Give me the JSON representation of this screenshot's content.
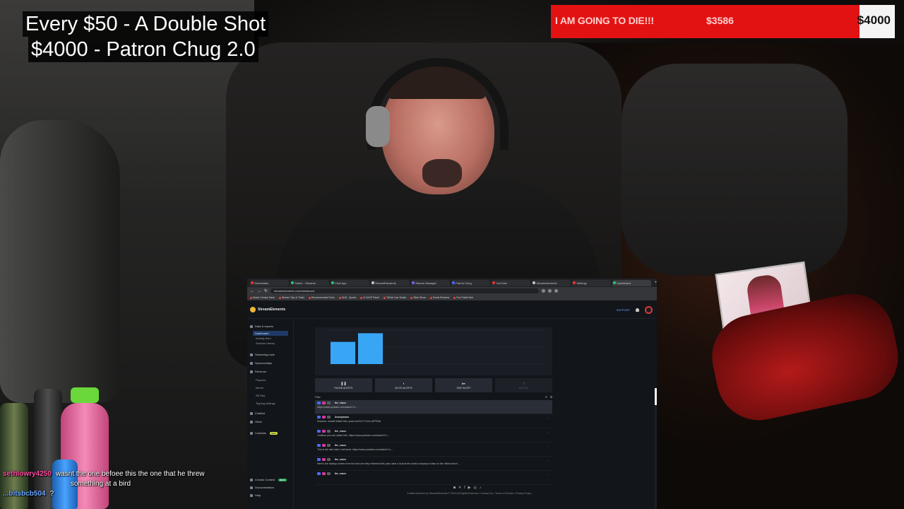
{
  "overlay": {
    "line1": "Every $50 - A Double Shot",
    "line2": "$4000 - Patron Chug 2.0"
  },
  "goal": {
    "title": "I AM GOING TO DIE!!!",
    "current": "$3586",
    "target": "$4000",
    "progress_fraction": 0.8965,
    "fill_color": "#e31212"
  },
  "browser": {
    "tabs": [
      {
        "label": "Streamlabs",
        "dot": "#e33"
      },
      {
        "label": "Twitch - Streams",
        "dot": "#29c66f"
      },
      {
        "label": "Chat App",
        "dot": "#29c66f"
      },
      {
        "label": "StreamElements",
        "dot": "#c9c9c9"
      },
      {
        "label": "Stream Manager",
        "dot": "#7a5cff"
      },
      {
        "label": "Patron Chug",
        "dot": "#4b6bff"
      },
      {
        "label": "YouTube",
        "dot": "#e33"
      },
      {
        "label": "Streamelements",
        "dot": "#c9c9c9"
      },
      {
        "label": "Settings",
        "dot": "#e33"
      },
      {
        "label": "Dashboard",
        "dot": "#29c66f"
      }
    ],
    "url": "streamelements.com/dashboard",
    "bookmarks": [
      "Music Creator Dash",
      "Stream Tips & Tricks",
      "Recommended Tools",
      "MLB - Sports",
      "NJ MVP Panel",
      "TikTok Live Studio",
      "Slide Show",
      "Guest Reviews",
      "Run Twitch Bot"
    ]
  },
  "app": {
    "brand": "StreamElements",
    "support_label": "SUPPORT",
    "sidebar": [
      {
        "label": "Data & reports",
        "type": "section"
      },
      {
        "label": "Dashboard",
        "type": "active"
      },
      {
        "label": "Activity feed",
        "type": "sub"
      },
      {
        "label": "Session history",
        "type": "sub"
      },
      {
        "label": "Streaming tools",
        "type": "section"
      },
      {
        "label": "Sponsorships",
        "type": "section"
      },
      {
        "label": "Revenue",
        "type": "section"
      },
      {
        "label": "Payouts",
        "type": "sub"
      },
      {
        "label": "Merch",
        "type": "sub"
      },
      {
        "label": "SE.Pay",
        "type": "sub"
      },
      {
        "label": "Tipping settings",
        "type": "sub"
      },
      {
        "label": "Chatbot",
        "type": "section"
      },
      {
        "label": "Other",
        "type": "section"
      },
      {
        "label": "Contests",
        "type": "section",
        "badge": "NEW"
      },
      {
        "label": "Creator Contest",
        "type": "bottom",
        "badge": "BETA"
      },
      {
        "label": "Documentation",
        "type": "bottom"
      },
      {
        "label": "Help",
        "type": "bottom"
      }
    ],
    "chart_data": {
      "type": "bar",
      "categories": [
        "",
        "",
        "",
        "",
        "",
        "",
        "",
        ""
      ],
      "values": [
        36,
        50,
        0,
        0,
        0,
        0,
        0,
        0
      ],
      "ylim": [
        0,
        55
      ],
      "bar_color": "#39a6f5"
    },
    "alert_buttons": [
      {
        "label": "PAUSE ALERTS",
        "icon": "pause-icon",
        "enabled": true
      },
      {
        "label": "MUTE ALERTS",
        "icon": "mute-icon",
        "enabled": true
      },
      {
        "label": "SKIP ALERT",
        "icon": "skip-icon",
        "enabled": true
      },
      {
        "label": "REPLAY",
        "icon": "replay-icon",
        "enabled": false
      }
    ],
    "filter_label": "Filter",
    "feed": [
      {
        "name": "the_maxx",
        "text": "https://www.youtube.com/watch?v=...",
        "highlight": true
      },
      {
        "name": "Anonymous",
        "text": "Surprise, media! Watch this: youtu.be/ZLVY7vmLcDPDWs",
        "highlight": false
      },
      {
        "name": "the_maxx",
        "text": "I believe you can watch this: https://www.youtube.com/watch?v=...",
        "highlight": false
      },
      {
        "name": "the_maxx",
        "text": "This is the last video I will send: https://www.youtube.com/watch?v=...",
        "highlight": false
      },
      {
        "name": "the_maxx",
        "text": "Here's the backup screen from the and one they reviewed this year, take a look at the worst company to take on the 'afford show' ...",
        "highlight": false
      },
      {
        "name": "the_maxx",
        "text": "",
        "highlight": false
      }
    ],
    "copyright": "Crafted with love by StreamElements © 2024 All Rights Reserved • Contact Us • Terms of Service • Privacy Policy"
  },
  "chat": [
    {
      "user": "sethlowry4250",
      "message": "wasnt the one befoee this the one that he threw"
    },
    {
      "user": "",
      "message": "something at a bird"
    },
    {
      "user": "...bitsbcb504",
      "message": "?"
    }
  ]
}
